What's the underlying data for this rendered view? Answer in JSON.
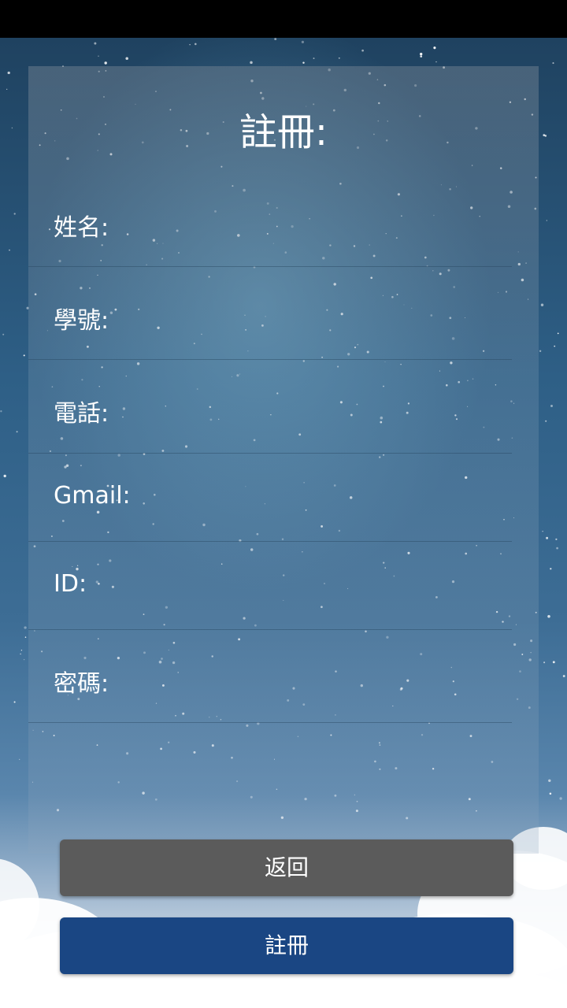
{
  "title": "註冊:",
  "fields": [
    {
      "label": "姓名:",
      "value": ""
    },
    {
      "label": "學號:",
      "value": ""
    },
    {
      "label": "電話:",
      "value": ""
    },
    {
      "label": "Gmail:",
      "value": ""
    },
    {
      "label": "ID:",
      "value": ""
    },
    {
      "label": "密碼:",
      "value": ""
    }
  ],
  "buttons": {
    "back_label": "返回",
    "register_label": "註冊"
  },
  "colors": {
    "back_button": "#5b5b5b",
    "register_button": "#1a4683",
    "status_bar": "#000000"
  }
}
